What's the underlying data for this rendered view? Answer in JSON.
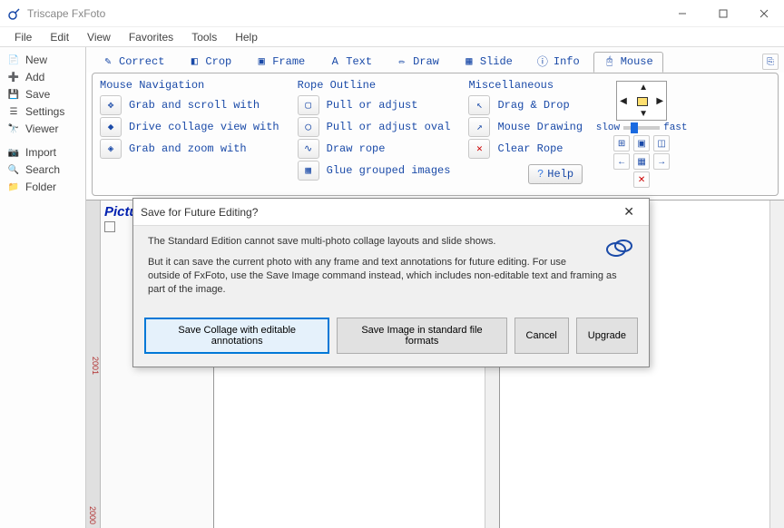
{
  "window": {
    "title": "Triscape FxFoto"
  },
  "menu": [
    "File",
    "Edit",
    "View",
    "Favorites",
    "Tools",
    "Help"
  ],
  "left_buttons": [
    {
      "icon": "new",
      "label": "New"
    },
    {
      "icon": "add",
      "label": "Add"
    },
    {
      "icon": "save",
      "label": "Save"
    },
    {
      "icon": "settings",
      "label": "Settings"
    },
    {
      "icon": "viewer",
      "label": "Viewer"
    },
    {
      "icon": "import",
      "label": "Import"
    },
    {
      "icon": "search",
      "label": "Search"
    },
    {
      "icon": "folder",
      "label": "Folder"
    }
  ],
  "tabs": [
    {
      "icon": "correct",
      "label": "Correct"
    },
    {
      "icon": "crop",
      "label": "Crop"
    },
    {
      "icon": "frame",
      "label": "Frame"
    },
    {
      "icon": "text",
      "label": "Text"
    },
    {
      "icon": "draw",
      "label": "Draw"
    },
    {
      "icon": "slide",
      "label": "Slide"
    },
    {
      "icon": "info",
      "label": "Info"
    },
    {
      "icon": "mouse",
      "label": "Mouse"
    }
  ],
  "tab_selected": 7,
  "groups": {
    "nav": {
      "title": "Mouse Navigation",
      "rows": [
        "Grab and scroll with",
        "Drive collage view with",
        "Grab and zoom with"
      ]
    },
    "rope": {
      "title": "Rope Outline",
      "rows": [
        "Pull or adjust",
        "Pull or adjust oval",
        "Draw rope",
        "Glue grouped images"
      ]
    },
    "misc": {
      "title": "Miscellaneous",
      "rows": [
        "Drag & Drop",
        "Mouse Drawing",
        "Clear Rope"
      ]
    }
  },
  "help_label": "Help",
  "navpad": {
    "slow": "slow",
    "fast": "fast"
  },
  "sidebar": {
    "heading": "Pictures",
    "year_top": "2001",
    "year_bottom": "2000"
  },
  "dialog": {
    "title": "Save for Future Editing?",
    "p1": "The Standard Edition cannot save multi-photo collage layouts and slide shows.",
    "p2": "But it can save the current photo with any frame and text annotations for future editing. For use outside of FxFoto, use the Save Image command instead, which includes non-editable text and framing as part of the image.",
    "buttons": {
      "save_collage": "Save Collage with editable annotations",
      "save_image": "Save Image in standard file formats",
      "cancel": "Cancel",
      "upgrade": "Upgrade"
    }
  }
}
